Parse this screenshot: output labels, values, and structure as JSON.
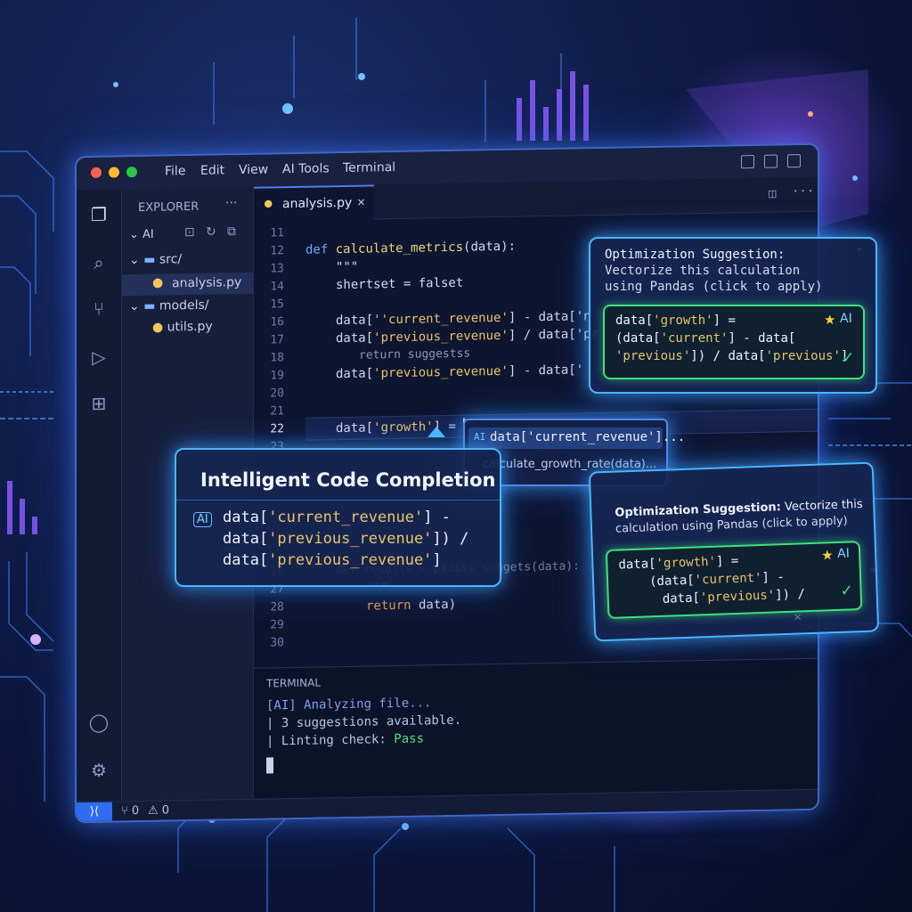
{
  "menu": [
    "File",
    "Edit",
    "View",
    "AI Tools",
    "Terminal"
  ],
  "explorer": {
    "title": "EXPLORER",
    "more": "···",
    "root": "AI",
    "items": [
      {
        "label": "src/",
        "type": "folder"
      },
      {
        "label": "analysis.py",
        "type": "file"
      },
      {
        "label": "models/",
        "type": "folder"
      },
      {
        "label": "utils.py",
        "type": "file"
      }
    ]
  },
  "editor": {
    "tab_label": "analysis.py",
    "tab_close": "×",
    "line_numbers": [
      "11",
      "12",
      "13",
      "14",
      "15",
      "16",
      "17",
      "18",
      "19",
      "20",
      "21",
      "22",
      "23",
      "",
      "",
      "",
      "26",
      "27",
      "28",
      "29",
      "30"
    ],
    "lines": {
      "l12_kw": "def",
      "l12_fn": "calculate_metrics",
      "l12_rest": "(data):",
      "l13": "\"\"\"",
      "l14": "shertset = falset",
      "l16_a": "data[",
      "l16_s": "''current_revenue'",
      "l16_b": "] - data['n",
      "l17_a": "data[",
      "l17_s": "'previous_revenue'",
      "l17_b": "] / data['pr",
      "l18": "return suggestss",
      "l19_a": "data[",
      "l19_s": "'previous_revenue'",
      "l19_b": "] - data['",
      "l22_a": "data[",
      "l22_s": "'growth'",
      "l22_b": "] = ",
      "l26": "def results = padits_suggets(data):",
      "l27": "\"\"\"",
      "l28_kw": "return",
      "l28_rest": " data)"
    }
  },
  "autocomplete": {
    "items": [
      "data['current_revenue']...",
      "calculate_growth_rate(data)..."
    ]
  },
  "completion_popup": {
    "title": "Intelligent Code Completion",
    "badge": "AI",
    "line1_a": "data[",
    "line1_s": "'current_revenue'",
    "line1_b": "] -",
    "line2_a": "data[",
    "line2_s": "'previous_revenue'",
    "line2_b": "]) /",
    "line3_a": "data[",
    "line3_s": "'previous_revenue'",
    "line3_b": "]"
  },
  "suggestion_top": {
    "title": "Optimization Suggestion:",
    "desc1": "Vectorize this calculation",
    "desc2": "using Pandas (click to apply)",
    "badge": "AI",
    "code1_a": "data[",
    "code1_s": "'growth'",
    "code1_b": "] =",
    "code2_a": "(data[",
    "code2_s": "'current'",
    "code2_b": "] - data[",
    "code3_s": "'previous'",
    "code3_b": "]) / data[",
    "code3_s2": "'previous'",
    "code3_c": "]"
  },
  "suggestion_bottom": {
    "title": "Optimization Suggestion:",
    "desc1": " Vectorize this",
    "desc2": "calculation using Pandas (click to apply)",
    "badge": "AI",
    "code1_a": "data[",
    "code1_s": "'growth'",
    "code1_b": "] =",
    "code2_a": "(data[",
    "code2_s": "'current'",
    "code2_b": "] -",
    "code3_a": "data[",
    "code3_s": "'previous'",
    "code3_b": "]) /",
    "close": "×"
  },
  "terminal": {
    "title": "TERMINAL",
    "line1": "[AI] Analyzing file...",
    "line2": "| 3 suggestions available.",
    "line3_a": "| Linting check: ",
    "line3_b": "Pass"
  },
  "statusbar": {
    "branch": "⑂ 0",
    "warnings": "⚠ 0"
  },
  "colors": {
    "accent": "#4f7df0",
    "glow": "#49b6ff",
    "success": "#3fe07a",
    "string": "#e9c46a"
  }
}
